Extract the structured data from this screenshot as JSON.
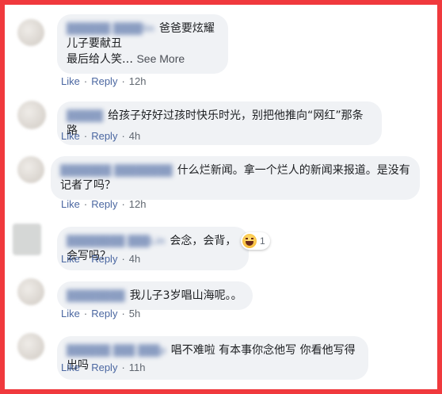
{
  "actions": {
    "like": "Like",
    "reply": "Reply",
    "separator": "·"
  },
  "comments": [
    {
      "author": "██████ ████lin",
      "lines": [
        "爸爸要炫耀",
        "儿子要献丑",
        "最后给人笑…"
      ],
      "see_more": "See More",
      "time": "12h"
    },
    {
      "author": "█████",
      "text": "给孩子好好过孩时快乐时光，别把他推向“网红”那条路",
      "time": "4h"
    },
    {
      "author": "███████ ████████",
      "text": "什么烂新闻。拿一个烂人的新闻来报道。是没有记者了吗？",
      "time": "12h"
    },
    {
      "author": "████████ ███Lin",
      "text": "会念，会背，会写吗？",
      "reaction_count": "1",
      "time": "4h"
    },
    {
      "author": "████████",
      "text": "我儿子3岁唱山海呢。。",
      "time": "5h"
    },
    {
      "author": "██████ ███ ███p",
      "text": "唱不难啦 有本事你念他写 你看他写得出吗",
      "time": "11h"
    }
  ],
  "colors": {
    "border": "#f0393d",
    "bubble": "#f0f2f5",
    "link": "#4b67a1"
  }
}
